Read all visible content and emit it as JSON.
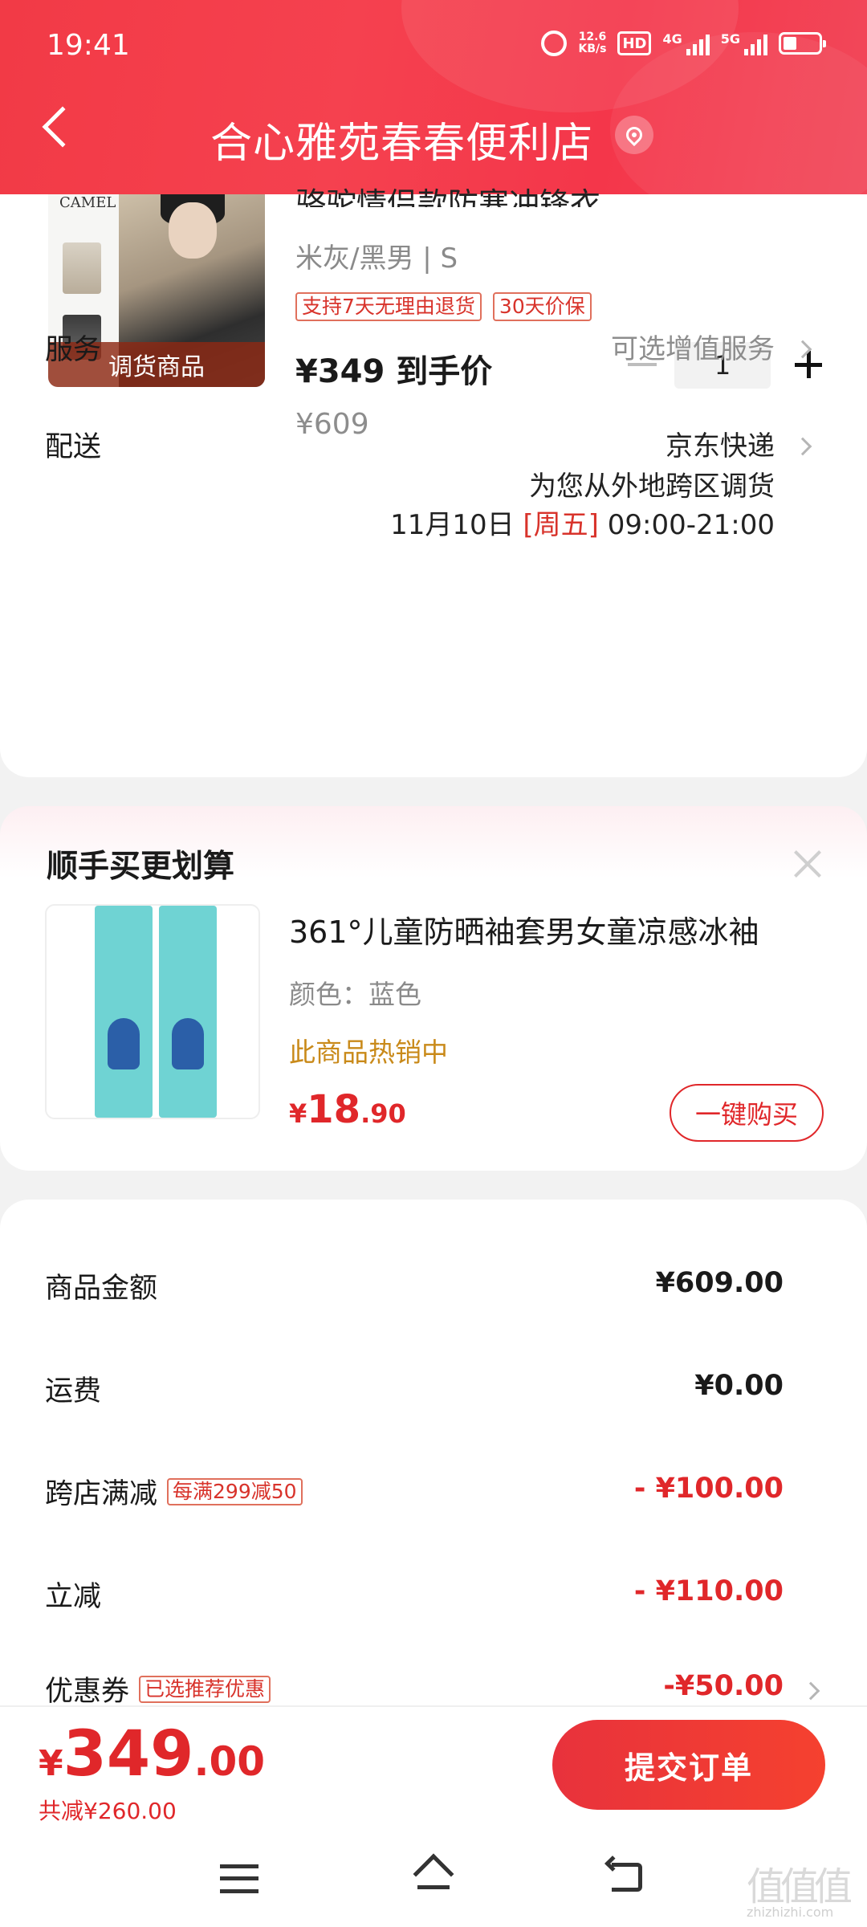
{
  "status_bar": {
    "time": "19:41",
    "speed_value": "12.6",
    "speed_unit": "KB/s",
    "hd": "HD",
    "net1": "4G",
    "net2": "5G"
  },
  "header": {
    "store_name": "合心雅苑春春便利店",
    "icons": [
      "back-icon",
      "location-icon"
    ]
  },
  "product": {
    "brand": "CAMEL",
    "title": "骆驼情侣款防寒冲锋衣",
    "variant": "米灰/黑男 | S",
    "tags": [
      "支持7天无理由退货",
      "30天价保"
    ],
    "image_badge": "调货商品",
    "deal_price": "¥349 到手价",
    "original_price": "¥609",
    "quantity": "1"
  },
  "service": {
    "label": "服务",
    "value": "可选增值服务"
  },
  "delivery": {
    "label": "配送",
    "carrier": "京东快递",
    "note": "为您从外地跨区调货",
    "date": "11月10日",
    "weekday": "[周五]",
    "time_window": "09:00-21:00"
  },
  "recommendation": {
    "section_title": "顺手买更划算",
    "name": "361°儿童防晒袖套男女童凉感冰袖",
    "color": "颜色：蓝色",
    "hot_label": "此商品热销中",
    "price_currency": "¥",
    "price_int": "18",
    "price_dec": ".90",
    "buy_label": "一键购买"
  },
  "summary": {
    "rows": [
      {
        "label": "商品金额",
        "tag": "",
        "value": "¥609.00"
      },
      {
        "label": "运费",
        "tag": "",
        "value": "¥0.00"
      },
      {
        "label": "跨店满减",
        "tag": "每满299减50",
        "value": "- ¥100.00"
      },
      {
        "label": "立减",
        "tag": "",
        "value": "- ¥110.00"
      },
      {
        "label": "优惠券",
        "tag": "已选推荐优惠",
        "value": "-¥50.00"
      }
    ]
  },
  "footer": {
    "total_currency": "¥",
    "total_int": "349",
    "total_dec": ".00",
    "saved": "共减¥260.00",
    "submit_label": "提交订单"
  },
  "watermark": {
    "main": "值值值",
    "sub": "zhizhizhi.com"
  },
  "colors": {
    "header_red": "#f23a46",
    "price_red": "#e0272a",
    "hot_orange": "#c98a1a"
  }
}
